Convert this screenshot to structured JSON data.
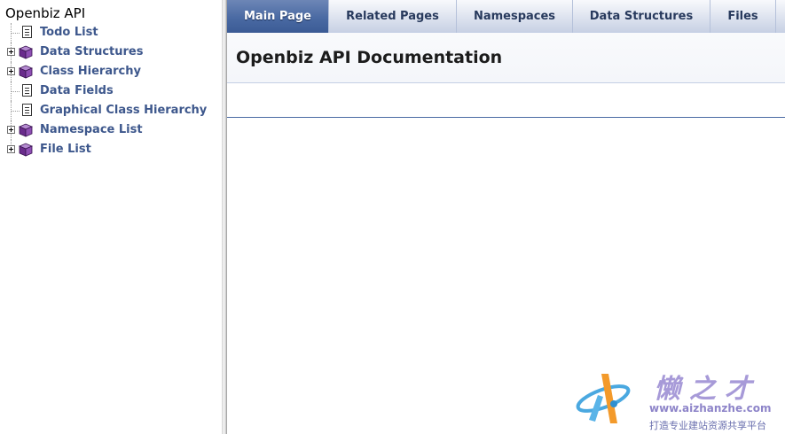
{
  "tree": {
    "title": "Openbiz API",
    "items": [
      {
        "label": "Todo List",
        "icon": "page-icon",
        "expandable": false
      },
      {
        "label": "Data Structures",
        "icon": "book-icon",
        "expandable": true
      },
      {
        "label": "Class Hierarchy",
        "icon": "book-icon",
        "expandable": true
      },
      {
        "label": "Data Fields",
        "icon": "page-icon",
        "expandable": false
      },
      {
        "label": "Graphical Class Hierarchy",
        "icon": "page-icon",
        "expandable": false
      },
      {
        "label": "Namespace List",
        "icon": "book-icon",
        "expandable": true
      },
      {
        "label": "File List",
        "icon": "book-icon",
        "expandable": true
      }
    ]
  },
  "tabs": [
    {
      "label": "Main Page",
      "active": true
    },
    {
      "label": "Related Pages",
      "active": false
    },
    {
      "label": "Namespaces",
      "active": false
    },
    {
      "label": "Data Structures",
      "active": false
    },
    {
      "label": "Files",
      "active": false
    }
  ],
  "header": {
    "title": "Openbiz API Documentation"
  },
  "watermark": {
    "chinese": "懒之才",
    "url": "www.aizhanzhe.com",
    "slogan": "打造专业建站资源共享平台"
  },
  "colors": {
    "link": "#3d578c",
    "active_tab": "#4a6aa3",
    "book_icon": "#6a2c8c",
    "watermark": "#a79ad8"
  }
}
